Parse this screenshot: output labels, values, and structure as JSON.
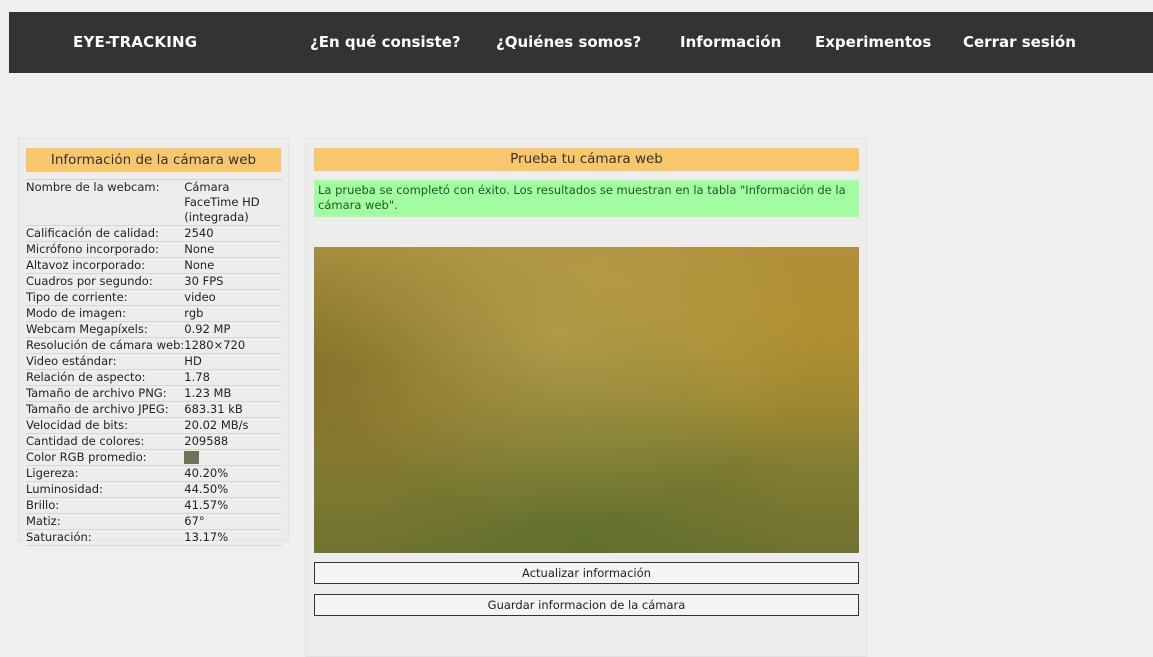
{
  "header": {
    "brand": "EYE-TRACKING",
    "nav": [
      {
        "label": "¿En qué consiste?"
      },
      {
        "label": "¿Quiénes somos?"
      },
      {
        "label": "Información"
      },
      {
        "label": "Experimentos"
      },
      {
        "label": "Cerrar sesión"
      }
    ]
  },
  "info_panel": {
    "title": "Información de la cámara web",
    "rows": [
      {
        "label": "Nombre de la webcam:",
        "value": "Cámara FaceTime HD (integrada)"
      },
      {
        "label": "Calificación de calidad:",
        "value": "2540"
      },
      {
        "label": "Micrófono incorporado:",
        "value": "None"
      },
      {
        "label": "Altavoz incorporado:",
        "value": "None"
      },
      {
        "label": "Cuadros por segundo:",
        "value": "30 FPS"
      },
      {
        "label": "Tipo de corriente:",
        "value": "video"
      },
      {
        "label": "Modo de imagen:",
        "value": "rgb"
      },
      {
        "label": "Webcam Megapíxels:",
        "value": "0.92 MP"
      },
      {
        "label": "Resolución de cámara web:",
        "value": "1280×720"
      },
      {
        "label": "Video estándar:",
        "value": "HD"
      },
      {
        "label": "Relación de aspecto:",
        "value": "1.78"
      },
      {
        "label": "Tamaño de archivo PNG:",
        "value": "1.23 MB"
      },
      {
        "label": "Tamaño de archivo JPEG:",
        "value": "683.31 kB"
      },
      {
        "label": "Velocidad de bits:",
        "value": "20.02 MB/s"
      },
      {
        "label": "Cantidad de colores:",
        "value": "209588"
      },
      {
        "label": "Color RGB promedio:",
        "value": ""
      },
      {
        "label": "Ligereza:",
        "value": "40.20%"
      },
      {
        "label": "Luminosidad:",
        "value": "44.50%"
      },
      {
        "label": "Brillo:",
        "value": "41.57%"
      },
      {
        "label": "Matiz:",
        "value": "67°"
      },
      {
        "label": "Saturación:",
        "value": "13.17%"
      }
    ],
    "average_color": "#737256"
  },
  "test_panel": {
    "title": "Prueba tu cámara web",
    "success_message": "La prueba se completó con éxito. Los resultados se muestran en la tabla \"Información de la cámara web\".",
    "update_button": "Actualizar información",
    "save_button": "Guardar informacion de la cámara"
  },
  "colors": {
    "nav_bg": "#333333",
    "header_accent": "#f9c76b",
    "success_bg": "#a3fda3",
    "page_bg": "#efefef"
  }
}
